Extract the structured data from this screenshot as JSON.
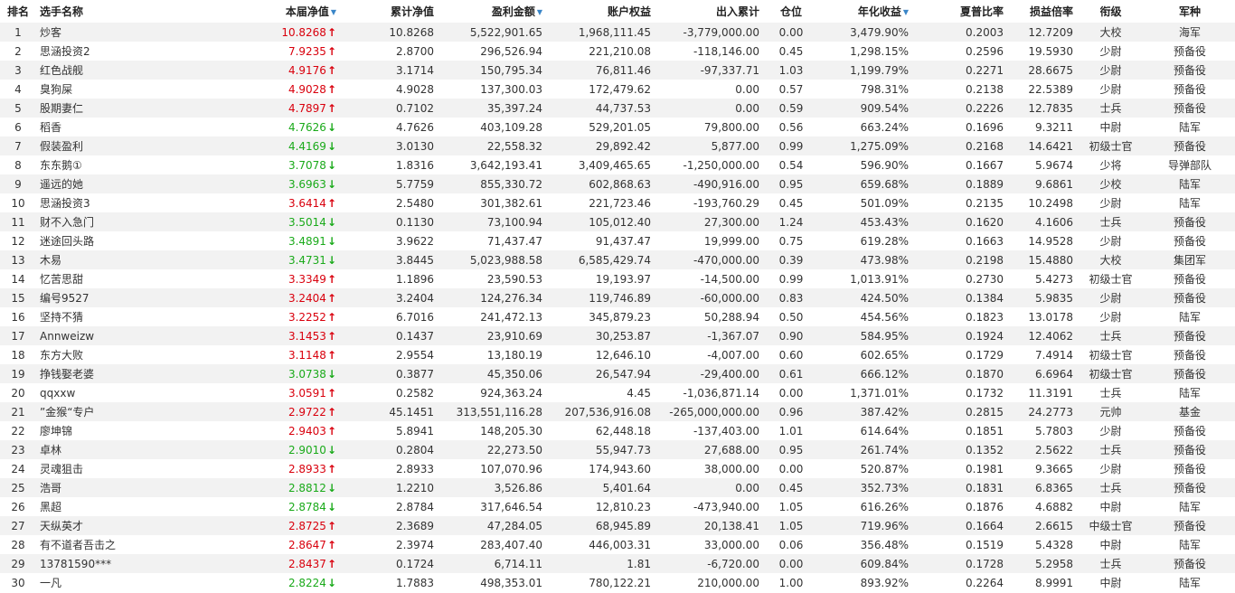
{
  "headers": {
    "rank": "排名",
    "name": "选手名称",
    "nav": "本届净值",
    "cum_nav": "累计净值",
    "profit": "盈利金额",
    "equity": "账户权益",
    "inout": "出入累计",
    "position": "仓位",
    "annual": "年化收益",
    "sharpe": "夏普比率",
    "pl_ratio": "损益倍率",
    "rank_title": "衔级",
    "branch": "军种"
  },
  "sort_icon": "sort-down-icon",
  "colors": {
    "up": "#d9000d",
    "down": "#1aaa1a",
    "stripe": "#f2f2f2",
    "sort": "#3a86c8"
  },
  "rows": [
    {
      "rank": "1",
      "name": "炒客",
      "nav": "10.8268",
      "dir": "up",
      "cum": "10.8268",
      "profit": "5,522,901.65",
      "equity": "1,968,111.45",
      "inout": "-3,779,000.00",
      "pos": "0.00",
      "annual": "3,479.90%",
      "sharpe": "0.2003",
      "pl": "12.7209",
      "title": "大校",
      "branch": "海军"
    },
    {
      "rank": "2",
      "name": "思涵投资2",
      "nav": "7.9235",
      "dir": "up",
      "cum": "2.8700",
      "profit": "296,526.94",
      "equity": "221,210.08",
      "inout": "-118,146.00",
      "pos": "0.45",
      "annual": "1,298.15%",
      "sharpe": "0.2596",
      "pl": "19.5930",
      "title": "少尉",
      "branch": "预备役"
    },
    {
      "rank": "3",
      "name": "红色战舰",
      "nav": "4.9176",
      "dir": "up",
      "cum": "3.1714",
      "profit": "150,795.34",
      "equity": "76,811.46",
      "inout": "-97,337.71",
      "pos": "1.03",
      "annual": "1,199.79%",
      "sharpe": "0.2271",
      "pl": "28.6675",
      "title": "少尉",
      "branch": "预备役"
    },
    {
      "rank": "4",
      "name": "臭狗屎",
      "nav": "4.9028",
      "dir": "up",
      "cum": "4.9028",
      "profit": "137,300.03",
      "equity": "172,479.62",
      "inout": "0.00",
      "pos": "0.57",
      "annual": "798.31%",
      "sharpe": "0.2138",
      "pl": "22.5389",
      "title": "少尉",
      "branch": "预备役"
    },
    {
      "rank": "5",
      "name": "股期妻仁",
      "nav": "4.7897",
      "dir": "up",
      "cum": "0.7102",
      "profit": "35,397.24",
      "equity": "44,737.53",
      "inout": "0.00",
      "pos": "0.59",
      "annual": "909.54%",
      "sharpe": "0.2226",
      "pl": "12.7835",
      "title": "士兵",
      "branch": "预备役"
    },
    {
      "rank": "6",
      "name": "稻香",
      "nav": "4.7626",
      "dir": "down",
      "cum": "4.7626",
      "profit": "403,109.28",
      "equity": "529,201.05",
      "inout": "79,800.00",
      "pos": "0.56",
      "annual": "663.24%",
      "sharpe": "0.1696",
      "pl": "9.3211",
      "title": "中尉",
      "branch": "陆军"
    },
    {
      "rank": "7",
      "name": "假装盈利",
      "nav": "4.4169",
      "dir": "down",
      "cum": "3.0130",
      "profit": "22,558.32",
      "equity": "29,892.42",
      "inout": "5,877.00",
      "pos": "0.99",
      "annual": "1,275.09%",
      "sharpe": "0.2168",
      "pl": "14.6421",
      "title": "初级士官",
      "branch": "预备役"
    },
    {
      "rank": "8",
      "name": "东东鹅①",
      "nav": "3.7078",
      "dir": "down",
      "cum": "1.8316",
      "profit": "3,642,193.41",
      "equity": "3,409,465.65",
      "inout": "-1,250,000.00",
      "pos": "0.54",
      "annual": "596.90%",
      "sharpe": "0.1667",
      "pl": "5.9674",
      "title": "少将",
      "branch": "导弹部队"
    },
    {
      "rank": "9",
      "name": "遥远的她",
      "nav": "3.6963",
      "dir": "down",
      "cum": "5.7759",
      "profit": "855,330.72",
      "equity": "602,868.63",
      "inout": "-490,916.00",
      "pos": "0.95",
      "annual": "659.68%",
      "sharpe": "0.1889",
      "pl": "9.6861",
      "title": "少校",
      "branch": "陆军"
    },
    {
      "rank": "10",
      "name": "思涵投资3",
      "nav": "3.6414",
      "dir": "up",
      "cum": "2.5480",
      "profit": "301,382.61",
      "equity": "221,723.46",
      "inout": "-193,760.29",
      "pos": "0.45",
      "annual": "501.09%",
      "sharpe": "0.2135",
      "pl": "10.2498",
      "title": "少尉",
      "branch": "陆军"
    },
    {
      "rank": "11",
      "name": "财不入急门",
      "nav": "3.5014",
      "dir": "down",
      "cum": "0.1130",
      "profit": "73,100.94",
      "equity": "105,012.40",
      "inout": "27,300.00",
      "pos": "1.24",
      "annual": "453.43%",
      "sharpe": "0.1620",
      "pl": "4.1606",
      "title": "士兵",
      "branch": "预备役"
    },
    {
      "rank": "12",
      "name": "迷途回头路",
      "nav": "3.4891",
      "dir": "down",
      "cum": "3.9622",
      "profit": "71,437.47",
      "equity": "91,437.47",
      "inout": "19,999.00",
      "pos": "0.75",
      "annual": "619.28%",
      "sharpe": "0.1663",
      "pl": "14.9528",
      "title": "少尉",
      "branch": "预备役"
    },
    {
      "rank": "13",
      "name": "木易",
      "nav": "3.4731",
      "dir": "down",
      "cum": "3.8445",
      "profit": "5,023,988.58",
      "equity": "6,585,429.74",
      "inout": "-470,000.00",
      "pos": "0.39",
      "annual": "473.98%",
      "sharpe": "0.2198",
      "pl": "15.4880",
      "title": "大校",
      "branch": "集团军"
    },
    {
      "rank": "14",
      "name": "忆苦思甜",
      "nav": "3.3349",
      "dir": "up",
      "cum": "1.1896",
      "profit": "23,590.53",
      "equity": "19,193.97",
      "inout": "-14,500.00",
      "pos": "0.99",
      "annual": "1,013.91%",
      "sharpe": "0.2730",
      "pl": "5.4273",
      "title": "初级士官",
      "branch": "预备役"
    },
    {
      "rank": "15",
      "name": "编号9527",
      "nav": "3.2404",
      "dir": "up",
      "cum": "3.2404",
      "profit": "124,276.34",
      "equity": "119,746.89",
      "inout": "-60,000.00",
      "pos": "0.83",
      "annual": "424.50%",
      "sharpe": "0.1384",
      "pl": "5.9835",
      "title": "少尉",
      "branch": "预备役"
    },
    {
      "rank": "16",
      "name": "坚持不猜",
      "nav": "3.2252",
      "dir": "up",
      "cum": "6.7016",
      "profit": "241,472.13",
      "equity": "345,879.23",
      "inout": "50,288.94",
      "pos": "0.50",
      "annual": "454.56%",
      "sharpe": "0.1823",
      "pl": "13.0178",
      "title": "少尉",
      "branch": "陆军"
    },
    {
      "rank": "17",
      "name": "Annweizw",
      "nav": "3.1453",
      "dir": "up",
      "cum": "0.1437",
      "profit": "23,910.69",
      "equity": "30,253.87",
      "inout": "-1,367.07",
      "pos": "0.90",
      "annual": "584.95%",
      "sharpe": "0.1924",
      "pl": "12.4062",
      "title": "士兵",
      "branch": "预备役"
    },
    {
      "rank": "18",
      "name": "东方大败",
      "nav": "3.1148",
      "dir": "up",
      "cum": "2.9554",
      "profit": "13,180.19",
      "equity": "12,646.10",
      "inout": "-4,007.00",
      "pos": "0.60",
      "annual": "602.65%",
      "sharpe": "0.1729",
      "pl": "7.4914",
      "title": "初级士官",
      "branch": "预备役"
    },
    {
      "rank": "19",
      "name": "挣钱娶老婆",
      "nav": "3.0738",
      "dir": "down",
      "cum": "0.3877",
      "profit": "45,350.06",
      "equity": "26,547.94",
      "inout": "-29,400.00",
      "pos": "0.61",
      "annual": "666.12%",
      "sharpe": "0.1870",
      "pl": "6.6964",
      "title": "初级士官",
      "branch": "预备役"
    },
    {
      "rank": "20",
      "name": "qqxxw",
      "nav": "3.0591",
      "dir": "up",
      "cum": "0.2582",
      "profit": "924,363.24",
      "equity": "4.45",
      "inout": "-1,036,871.14",
      "pos": "0.00",
      "annual": "1,371.01%",
      "sharpe": "0.1732",
      "pl": "11.3191",
      "title": "士兵",
      "branch": "陆军"
    },
    {
      "rank": "21",
      "name": "”金猴“专户",
      "nav": "2.9722",
      "dir": "up",
      "cum": "45.1451",
      "profit": "313,551,116.28",
      "equity": "207,536,916.08",
      "inout": "-265,000,000.00",
      "pos": "0.96",
      "annual": "387.42%",
      "sharpe": "0.2815",
      "pl": "24.2773",
      "title": "元帅",
      "branch": "基金"
    },
    {
      "rank": "22",
      "name": "廖坤锦",
      "nav": "2.9403",
      "dir": "up",
      "cum": "5.8941",
      "profit": "148,205.30",
      "equity": "62,448.18",
      "inout": "-137,403.00",
      "pos": "1.01",
      "annual": "614.64%",
      "sharpe": "0.1851",
      "pl": "5.7803",
      "title": "少尉",
      "branch": "预备役"
    },
    {
      "rank": "23",
      "name": "卓林",
      "nav": "2.9010",
      "dir": "down",
      "cum": "0.2804",
      "profit": "22,273.50",
      "equity": "55,947.73",
      "inout": "27,688.00",
      "pos": "0.95",
      "annual": "261.74%",
      "sharpe": "0.1352",
      "pl": "2.5622",
      "title": "士兵",
      "branch": "预备役"
    },
    {
      "rank": "24",
      "name": "灵魂狙击",
      "nav": "2.8933",
      "dir": "up",
      "cum": "2.8933",
      "profit": "107,070.96",
      "equity": "174,943.60",
      "inout": "38,000.00",
      "pos": "0.00",
      "annual": "520.87%",
      "sharpe": "0.1981",
      "pl": "9.3665",
      "title": "少尉",
      "branch": "预备役"
    },
    {
      "rank": "25",
      "name": "浩哥",
      "nav": "2.8812",
      "dir": "down",
      "cum": "1.2210",
      "profit": "3,526.86",
      "equity": "5,401.64",
      "inout": "0.00",
      "pos": "0.45",
      "annual": "352.73%",
      "sharpe": "0.1831",
      "pl": "6.8365",
      "title": "士兵",
      "branch": "预备役"
    },
    {
      "rank": "26",
      "name": "黑超",
      "nav": "2.8784",
      "dir": "down",
      "cum": "2.8784",
      "profit": "317,646.54",
      "equity": "12,810.23",
      "inout": "-473,940.00",
      "pos": "1.05",
      "annual": "616.26%",
      "sharpe": "0.1876",
      "pl": "4.6882",
      "title": "中尉",
      "branch": "陆军"
    },
    {
      "rank": "27",
      "name": "天纵英才",
      "nav": "2.8725",
      "dir": "up",
      "cum": "2.3689",
      "profit": "47,284.05",
      "equity": "68,945.89",
      "inout": "20,138.41",
      "pos": "1.05",
      "annual": "719.96%",
      "sharpe": "0.1664",
      "pl": "2.6615",
      "title": "中级士官",
      "branch": "预备役"
    },
    {
      "rank": "28",
      "name": "有不道者吾击之",
      "nav": "2.8647",
      "dir": "up",
      "cum": "2.3974",
      "profit": "283,407.40",
      "equity": "446,003.31",
      "inout": "33,000.00",
      "pos": "0.06",
      "annual": "356.48%",
      "sharpe": "0.1519",
      "pl": "5.4328",
      "title": "中尉",
      "branch": "陆军"
    },
    {
      "rank": "29",
      "name": "13781590***",
      "nav": "2.8437",
      "dir": "up",
      "cum": "0.1724",
      "profit": "6,714.11",
      "equity": "1.81",
      "inout": "-6,720.00",
      "pos": "0.00",
      "annual": "609.84%",
      "sharpe": "0.1728",
      "pl": "5.2958",
      "title": "士兵",
      "branch": "预备役"
    },
    {
      "rank": "30",
      "name": "一凡",
      "nav": "2.8224",
      "dir": "down",
      "cum": "1.7883",
      "profit": "498,353.01",
      "equity": "780,122.21",
      "inout": "210,000.00",
      "pos": "1.00",
      "annual": "893.92%",
      "sharpe": "0.2264",
      "pl": "8.9991",
      "title": "中尉",
      "branch": "陆军"
    }
  ]
}
